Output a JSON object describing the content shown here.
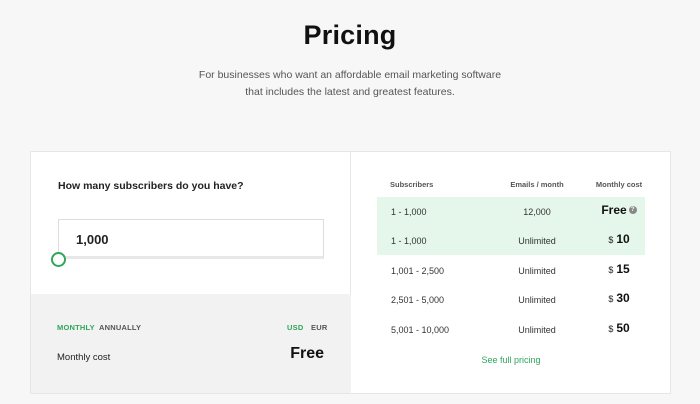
{
  "header": {
    "title": "Pricing",
    "subtitle": "For businesses who want an affordable email marketing software that includes the latest and greatest features."
  },
  "calculator": {
    "question": "How many subscribers do you have?",
    "subscribers_value": "1,000",
    "billing_tabs": {
      "monthly": "MONTHLY",
      "annually": "ANNUALLY",
      "active": "MONTHLY"
    },
    "currency_tabs": {
      "usd": "USD",
      "eur": "EUR",
      "active": "USD"
    },
    "cost_label": "Monthly cost",
    "cost_value": "Free"
  },
  "table": {
    "headers": [
      "Subscribers",
      "Emails / month",
      "Monthly cost"
    ],
    "rows": [
      {
        "subscribers": "1 - 1,000",
        "emails": "12,000",
        "currency": "",
        "cost": "Free",
        "highlighted": true,
        "help": "?"
      },
      {
        "subscribers": "1 - 1,000",
        "emails": "Unlimited",
        "currency": "$",
        "cost": "10",
        "highlighted": true
      },
      {
        "subscribers": "1,001 - 2,500",
        "emails": "Unlimited",
        "currency": "$",
        "cost": "15",
        "highlighted": false
      },
      {
        "subscribers": "2,501 - 5,000",
        "emails": "Unlimited",
        "currency": "$",
        "cost": "30",
        "highlighted": false
      },
      {
        "subscribers": "5,001 - 10,000",
        "emails": "Unlimited",
        "currency": "$",
        "cost": "50",
        "highlighted": false
      }
    ],
    "full_pricing_link": "See full pricing"
  },
  "colors": {
    "accent": "#2fa65a",
    "highlight": "#e4f7ea"
  }
}
